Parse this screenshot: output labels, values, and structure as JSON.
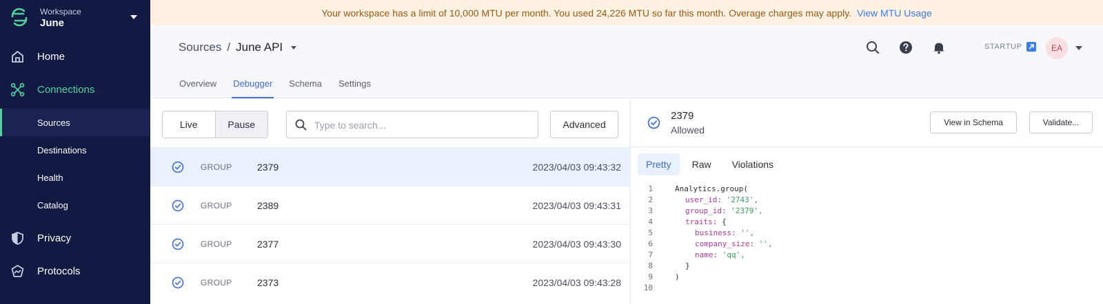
{
  "workspace": {
    "label": "Workspace",
    "name": "June"
  },
  "nav": {
    "home": "Home",
    "connections": "Connections",
    "sub": [
      "Sources",
      "Destinations",
      "Health",
      "Catalog"
    ],
    "privacy": "Privacy",
    "protocols": "Protocols"
  },
  "banner": {
    "text": "Your workspace has a limit of 10,000 MTU per month. You used 24,226 MTU so far this month. Overage charges may apply.",
    "link": "View MTU Usage"
  },
  "breadcrumb": {
    "parent": "Sources",
    "separator": "/",
    "current": "June API"
  },
  "header": {
    "plan": "STARTUP",
    "avatar": "EA"
  },
  "tabs": [
    "Overview",
    "Debugger",
    "Schema",
    "Settings"
  ],
  "toolbar": {
    "live": "Live",
    "pause": "Pause",
    "search_placeholder": "Type to search...",
    "advanced": "Advanced"
  },
  "events": [
    {
      "type": "GROUP",
      "id": "2379",
      "time": "2023/04/03 09:43:32"
    },
    {
      "type": "GROUP",
      "id": "2389",
      "time": "2023/04/03 09:43:31"
    },
    {
      "type": "GROUP",
      "id": "2377",
      "time": "2023/04/03 09:43:30"
    },
    {
      "type": "GROUP",
      "id": "2373",
      "time": "2023/04/03 09:43:28"
    }
  ],
  "detail": {
    "id": "2379",
    "status": "Allowed",
    "view_schema": "View in Schema",
    "validate": "Validate...",
    "view_tabs": [
      "Pretty",
      "Raw",
      "Violations"
    ]
  },
  "code": {
    "line_numbers": [
      "1",
      "2",
      "3",
      "4",
      "5",
      "6",
      "7",
      "8",
      "9",
      "10"
    ],
    "call": "Analytics.group(",
    "user_id_key": "user_id:",
    "user_id_val": "'2743',",
    "group_id_key": "group_id:",
    "group_id_val": "'2379',",
    "traits_key": "traits:",
    "traits_open": "{",
    "business_key": "business:",
    "business_val": "'',",
    "company_size_key": "company_size:",
    "company_size_val": "'',",
    "name_key": "name:",
    "name_val": "'qq',",
    "traits_close": "}",
    "call_close": ")"
  },
  "colors": {
    "sidebar": "#121a44",
    "accent_green": "#4fd39b",
    "accent_blue": "#3b6cd8",
    "banner_bg": "#fdf1e2",
    "banner_text": "#9c5a12"
  }
}
